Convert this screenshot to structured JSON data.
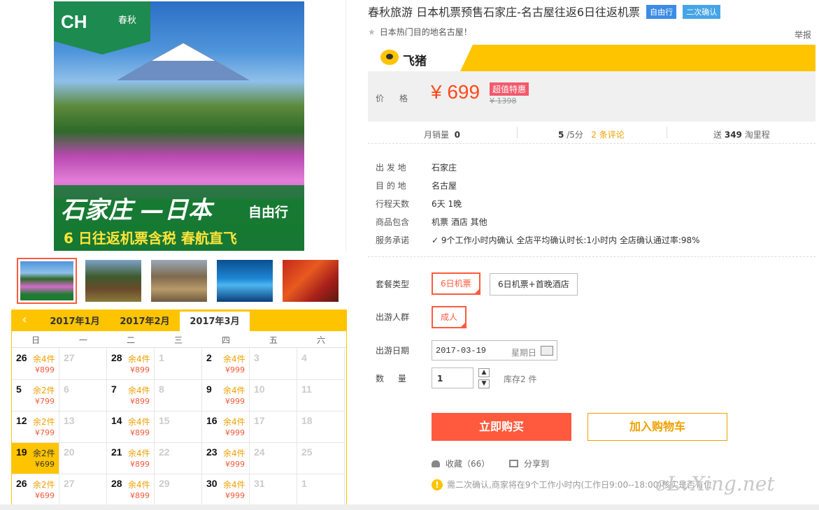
{
  "product": {
    "title": "春秋旅游 日本机票预售石家庄-名古屋往返6日往返机票",
    "tags": [
      "自由行",
      "二次确认"
    ],
    "subtitle": "日本热门目的地名古屋！",
    "report": "举报"
  },
  "main_image": {
    "logo_text": "CH",
    "logo_suffix": "春秋",
    "banner_line1": "石家庄 —日本",
    "banner_type": "自由行",
    "banner_line2": "6 日往返机票含税  春航直飞"
  },
  "price": {
    "brand": "飞猪",
    "label": "价格",
    "value": "¥ 699",
    "promo": "超值特惠",
    "original": "¥ 1398"
  },
  "stats": {
    "monthly_sales_label": "月销量",
    "monthly_sales": "0",
    "rating": "5",
    "rating_suffix": "/5分",
    "reviews": "2 条评论",
    "points_prefix": "送",
    "points": "349",
    "points_suffix": "淘里程"
  },
  "info": [
    {
      "k": "出 发 地",
      "v": "石家庄"
    },
    {
      "k": "目 的 地",
      "v": "名古屋"
    },
    {
      "k": "行程天数",
      "v": "6天 1晚"
    },
    {
      "k": "商品包含",
      "v": "机票   酒店   其他"
    },
    {
      "k": "服务承诺",
      "v": "9个工作小时内确认      全店平均确认时长:1小时内      全店确认通过率:98%"
    }
  ],
  "options": {
    "package_label": "套餐类型",
    "packages": [
      "6日机票",
      "6日机票+首晚酒店"
    ],
    "traveler_label": "出游人群",
    "traveler": "成人",
    "date_label": "出游日期",
    "date_value": "2017-03-19",
    "weekday": "星期日",
    "qty_label": "数  量",
    "qty_value": "1",
    "stock": "库存2 件"
  },
  "actions": {
    "buy": "立即购买",
    "cart": "加入购物车",
    "favorite": "收藏（66）",
    "share": "分享到",
    "notice": "需二次确认,商家将在9个工作小时内(工作日9:00--18:00)核实是否有位"
  },
  "watermark": "eLvXing.net",
  "calendar": {
    "tabs": [
      "2017年1月",
      "2017年2月",
      "2017年3月"
    ],
    "active_tab": 2,
    "weekdays": [
      "日",
      "一",
      "二",
      "三",
      "四",
      "五",
      "六"
    ],
    "rows": [
      [
        {
          "d": "26",
          "s": "余4件",
          "p": "¥899"
        },
        {
          "d": "27",
          "dim": true
        },
        {
          "d": "28",
          "s": "余4件",
          "p": "¥899"
        },
        {
          "d": "1",
          "dim": true
        },
        {
          "d": "2",
          "s": "余4件",
          "p": "¥999"
        },
        {
          "d": "3",
          "dim": true
        },
        {
          "d": "4",
          "dim": true
        }
      ],
      [
        {
          "d": "5",
          "s": "余2件",
          "p": "¥799"
        },
        {
          "d": "6",
          "dim": true
        },
        {
          "d": "7",
          "s": "余4件",
          "p": "¥899"
        },
        {
          "d": "8",
          "dim": true
        },
        {
          "d": "9",
          "s": "余4件",
          "p": "¥999"
        },
        {
          "d": "10",
          "dim": true
        },
        {
          "d": "11",
          "dim": true
        }
      ],
      [
        {
          "d": "12",
          "s": "余2件",
          "p": "¥799"
        },
        {
          "d": "13",
          "dim": true
        },
        {
          "d": "14",
          "s": "余4件",
          "p": "¥899"
        },
        {
          "d": "15",
          "dim": true
        },
        {
          "d": "16",
          "s": "余4件",
          "p": "¥999"
        },
        {
          "d": "17",
          "dim": true
        },
        {
          "d": "18",
          "dim": true
        }
      ],
      [
        {
          "d": "19",
          "s": "余2件",
          "p": "¥699",
          "sel": true
        },
        {
          "d": "20",
          "dim": true
        },
        {
          "d": "21",
          "s": "余4件",
          "p": "¥899"
        },
        {
          "d": "22",
          "dim": true
        },
        {
          "d": "23",
          "s": "余4件",
          "p": "¥999"
        },
        {
          "d": "24",
          "dim": true
        },
        {
          "d": "25",
          "dim": true
        }
      ],
      [
        {
          "d": "26",
          "s": "余2件",
          "p": "¥699"
        },
        {
          "d": "27",
          "dim": true
        },
        {
          "d": "28",
          "s": "余4件",
          "p": "¥899"
        },
        {
          "d": "29",
          "dim": true
        },
        {
          "d": "30",
          "s": "余4件",
          "p": "¥999"
        },
        {
          "d": "31",
          "dim": true
        },
        {
          "d": "1",
          "dim": true
        }
      ]
    ]
  },
  "colors": {
    "accent": "#ff5a3d",
    "calendar": "#ffc400",
    "price": "#ff4a1a",
    "tag": "#3c8ce6"
  }
}
